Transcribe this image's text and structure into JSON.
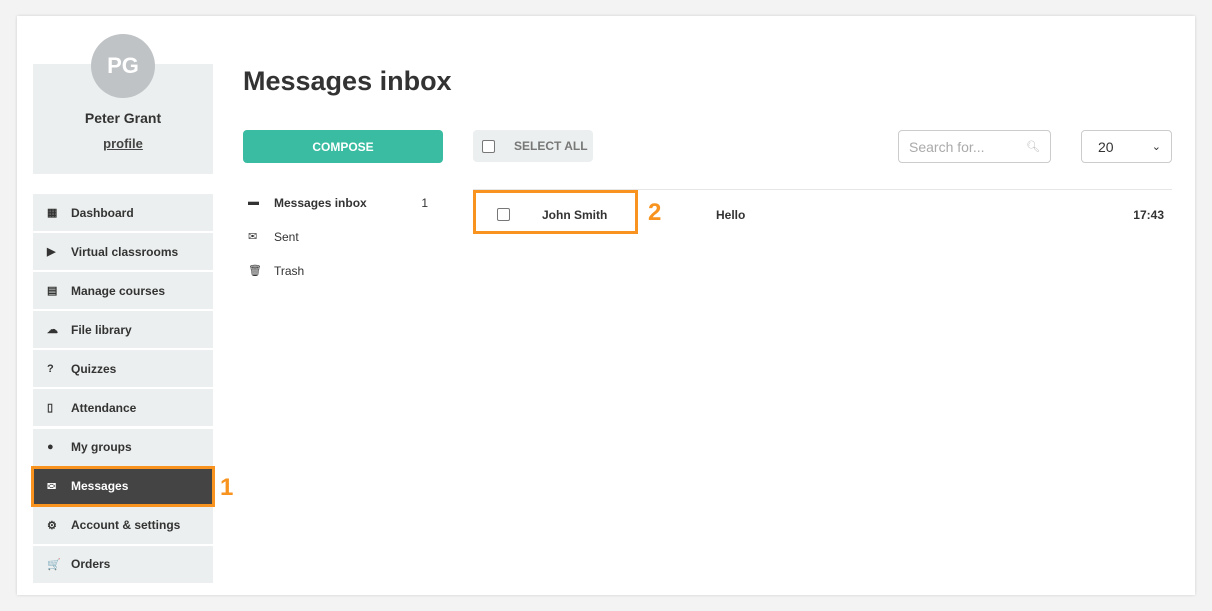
{
  "user": {
    "initials": "PG",
    "name": "Peter Grant",
    "profile_link": "profile"
  },
  "sidebar": {
    "items": [
      {
        "label": "Dashboard",
        "icon": "dashboard-icon",
        "glyph": "▦"
      },
      {
        "label": "Virtual classrooms",
        "icon": "play-circle-icon",
        "glyph": "▶"
      },
      {
        "label": "Manage courses",
        "icon": "book-icon",
        "glyph": "▤"
      },
      {
        "label": "File library",
        "icon": "cloud-upload-icon",
        "glyph": "☁"
      },
      {
        "label": "Quizzes",
        "icon": "question-circle-icon",
        "glyph": "?"
      },
      {
        "label": "Attendance",
        "icon": "file-text-icon",
        "glyph": "▯"
      },
      {
        "label": "My groups",
        "icon": "users-icon",
        "glyph": "●"
      },
      {
        "label": "Messages",
        "icon": "envelope-icon",
        "glyph": "✉",
        "active": true
      },
      {
        "label": "Account & settings",
        "icon": "gear-icon",
        "glyph": "⚙"
      },
      {
        "label": "Orders",
        "icon": "cart-icon",
        "glyph": "🛒"
      }
    ]
  },
  "annotations": {
    "marker1": "1",
    "marker2": "2",
    "accent": "#f7931e"
  },
  "main": {
    "title": "Messages inbox",
    "compose_label": "COMPOSE",
    "folders": [
      {
        "label": "Messages inbox",
        "count": "1",
        "icon": "archive-icon",
        "glyph": "▬"
      },
      {
        "label": "Sent",
        "icon": "envelope-icon",
        "glyph": "✉"
      },
      {
        "label": "Trash",
        "icon": "trash-icon",
        "glyph": "🗑"
      }
    ],
    "select_all_label": "SELECT ALL",
    "search": {
      "placeholder": "Search for..."
    },
    "per_page": "20",
    "messages": [
      {
        "sender": "John Smith",
        "subject": "Hello",
        "time": "17:43"
      }
    ]
  },
  "colors": {
    "compose": "#3abca2",
    "active_nav": "#444444",
    "sidebar_bg": "#ecefef"
  }
}
